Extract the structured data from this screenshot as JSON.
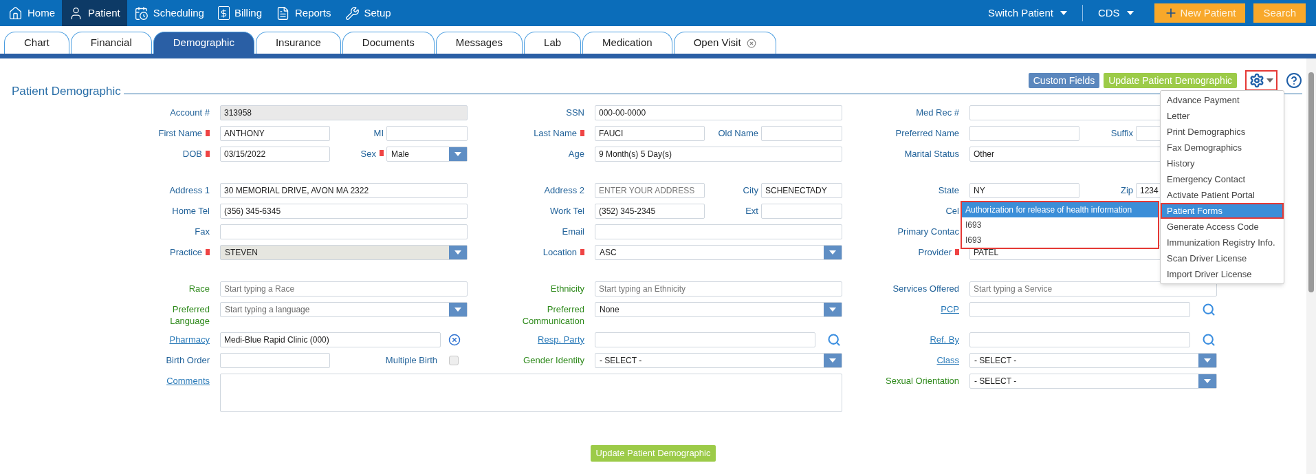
{
  "nav": {
    "items": [
      {
        "label": "Home",
        "selected": false
      },
      {
        "label": "Patient",
        "selected": true
      },
      {
        "label": "Scheduling",
        "selected": false
      },
      {
        "label": "Billing",
        "selected": false
      },
      {
        "label": "Reports",
        "selected": false
      },
      {
        "label": "Setup",
        "selected": false
      }
    ],
    "menus": [
      {
        "label": "Switch Patient"
      },
      {
        "label": "CDS"
      }
    ],
    "actions": [
      {
        "label": "New Patient",
        "kind": "add"
      },
      {
        "label": "Search",
        "kind": "plain"
      }
    ]
  },
  "tabs": [
    {
      "label": "Chart",
      "selected": false,
      "closable": false
    },
    {
      "label": "Financial",
      "selected": false,
      "closable": false
    },
    {
      "label": "Demographic",
      "selected": true,
      "closable": false
    },
    {
      "label": "Insurance",
      "selected": false,
      "closable": false
    },
    {
      "label": "Documents",
      "selected": false,
      "closable": false
    },
    {
      "label": "Messages",
      "selected": false,
      "closable": false
    },
    {
      "label": "Lab",
      "selected": false,
      "closable": false
    },
    {
      "label": "Medication",
      "selected": false,
      "closable": false
    },
    {
      "label": "Open Visit",
      "selected": false,
      "closable": true
    }
  ],
  "header": {
    "title": "Patient Demographic",
    "buttons": [
      {
        "label": "Custom Fields",
        "kind": "secondary"
      },
      {
        "label": "Update Patient Demographic",
        "kind": "primary"
      }
    ],
    "settings_highlighted": true
  },
  "form": {
    "sections": [
      {
        "rows": [
          [
            {
              "kind": "input",
              "label": {
                "text": "Account #",
                "kind": "plain",
                "required": false
              },
              "value": "313958",
              "disabled": true
            },
            {
              "kind": "input",
              "label": {
                "text": "SSN",
                "kind": "plain",
                "required": false
              },
              "value": "000-00-0000",
              "disabled": false
            },
            {
              "kind": "input",
              "label": {
                "text": "Med Rec #",
                "kind": "plain",
                "required": false
              },
              "disabled": false
            }
          ],
          [
            {
              "kind": "split",
              "label": {
                "text": "First Name",
                "kind": "plain",
                "required": true
              },
              "value": "ANTHONY",
              "second": {
                "kind": "input",
                "label": "MI",
                "required": false
              }
            },
            {
              "kind": "split",
              "label": {
                "text": "Last Name",
                "kind": "plain",
                "required": true
              },
              "value": "FAUCI",
              "second": {
                "kind": "input",
                "label": "Old Name",
                "required": false
              }
            },
            {
              "kind": "split",
              "label": {
                "text": "Preferred Name",
                "kind": "plain",
                "required": false
              },
              "second": {
                "kind": "input",
                "label": "Suffix",
                "required": false
              }
            }
          ],
          [
            {
              "kind": "split",
              "label": {
                "text": "DOB",
                "kind": "plain",
                "required": true
              },
              "value": "03/15/2022",
              "second": {
                "kind": "select",
                "label": "Sex",
                "required": true,
                "value": "Male"
              }
            },
            {
              "kind": "input",
              "label": {
                "text": "Age",
                "kind": "plain",
                "required": false
              },
              "value": "9 Month(s) 5 Day(s)",
              "disabled": false
            },
            {
              "kind": "input",
              "label": {
                "text": "Marital Status",
                "kind": "plain",
                "required": false
              },
              "value": "Other",
              "disabled": false
            }
          ]
        ]
      },
      {
        "rows": [
          [
            {
              "kind": "input",
              "label": {
                "text": "Address 1",
                "kind": "plain",
                "required": false
              },
              "value": "30 MEMORIAL DRIVE, AVON MA 2322",
              "disabled": false
            },
            {
              "kind": "split",
              "label": {
                "text": "Address 2",
                "kind": "plain",
                "required": false
              },
              "placeholder": "ENTER YOUR ADDRESS",
              "second": {
                "kind": "input",
                "label": "City",
                "required": false,
                "value": "SCHENECTADY"
              }
            },
            {
              "kind": "split",
              "label": {
                "text": "State",
                "kind": "plain",
                "required": false
              },
              "value": "NY",
              "second": {
                "kind": "input",
                "label": "Zip",
                "required": false,
                "value": "1234"
              }
            }
          ],
          [
            {
              "kind": "input",
              "label": {
                "text": "Home Tel",
                "kind": "plain",
                "required": false
              },
              "value": "(356) 345-6345",
              "disabled": false
            },
            {
              "kind": "split",
              "label": {
                "text": "Work Tel",
                "kind": "plain",
                "required": false
              },
              "value": "(352) 345-2345",
              "second": {
                "kind": "input",
                "label": "Ext",
                "required": false
              }
            },
            {
              "kind": "hidden",
              "label": {
                "text": "Cel",
                "kind": "plain",
                "required": false
              }
            }
          ],
          [
            {
              "kind": "input",
              "label": {
                "text": "Fax",
                "kind": "plain",
                "required": false
              },
              "disabled": false
            },
            {
              "kind": "input",
              "label": {
                "text": "Email",
                "kind": "plain",
                "required": false
              },
              "disabled": false
            },
            {
              "kind": "hidden",
              "label": {
                "text": "Primary Contac",
                "kind": "plain",
                "required": false
              }
            }
          ],
          [
            {
              "kind": "select",
              "label": {
                "text": "Practice",
                "kind": "plain",
                "required": true
              },
              "value": "STEVEN",
              "disabled": true
            },
            {
              "kind": "select",
              "label": {
                "text": "Location",
                "kind": "plain",
                "required": true
              },
              "value": "ASC",
              "disabled": false
            },
            {
              "kind": "input",
              "label": {
                "text": "Provider",
                "kind": "plain",
                "required": true
              },
              "value": "PATEL",
              "disabled": false
            }
          ]
        ]
      },
      {
        "rows": [
          [
            {
              "kind": "input",
              "label": {
                "text": "Race",
                "kind": "green",
                "required": false
              },
              "placeholder": "Start typing a Race",
              "disabled": false
            },
            {
              "kind": "input",
              "label": {
                "text": "Ethnicity",
                "kind": "green",
                "required": false
              },
              "placeholder": "Start typing an Ethnicity",
              "disabled": false
            },
            {
              "kind": "input",
              "label": {
                "text": "Services Offered",
                "kind": "plain",
                "required": false
              },
              "placeholder": "Start typing a Service",
              "disabled": false
            }
          ],
          [
            {
              "kind": "select",
              "label": {
                "text": "Preferred Language",
                "kind": "green",
                "required": false
              },
              "placeholder": "Start typing a language",
              "disabled": false
            },
            {
              "kind": "select",
              "label": {
                "text": "Preferred Communication",
                "kind": "green",
                "required": false
              },
              "value": "None",
              "disabled": false
            },
            {
              "kind": "search",
              "label": {
                "text": "PCP",
                "kind": "link",
                "required": false
              }
            }
          ],
          [
            {
              "kind": "clearable",
              "label": {
                "text": "Pharmacy",
                "kind": "link",
                "required": false
              },
              "value": "Medi-Blue Rapid Clinic (000)"
            },
            {
              "kind": "search",
              "label": {
                "text": "Resp. Party",
                "kind": "link",
                "required": false
              }
            },
            {
              "kind": "search",
              "label": {
                "text": "Ref. By",
                "kind": "link",
                "required": false
              }
            }
          ],
          [
            {
              "kind": "split",
              "label": {
                "text": "Birth Order",
                "kind": "plain",
                "required": false
              },
              "second": {
                "kind": "checkbox",
                "label": "Multiple Birth",
                "required": false,
                "checked": false
              }
            },
            {
              "kind": "select",
              "label": {
                "text": "Gender Identity",
                "kind": "green",
                "required": false
              },
              "value": "- SELECT -",
              "disabled": false
            },
            {
              "kind": "select",
              "label": {
                "text": "Class",
                "kind": "link",
                "required": false
              },
              "value": "- SELECT -",
              "disabled": false
            }
          ],
          [
            {
              "kind": "textarea",
              "label": {
                "text": "Comments",
                "kind": "link",
                "required": false
              }
            },
            "",
            {
              "kind": "select",
              "label": {
                "text": "Sexual Orientation",
                "kind": "green",
                "required": false
              },
              "value": "- SELECT -",
              "disabled": false
            }
          ]
        ]
      }
    ]
  },
  "footer_button": "Update Patient Demographic",
  "settings_menu": {
    "items": [
      {
        "label": "Advance Payment",
        "selected": false,
        "highlighted": false
      },
      {
        "label": "Letter",
        "selected": false,
        "highlighted": false
      },
      {
        "label": "Print Demographics",
        "selected": false,
        "highlighted": false
      },
      {
        "label": "Fax Demographics",
        "selected": false,
        "highlighted": false
      },
      {
        "label": "History",
        "selected": false,
        "highlighted": false
      },
      {
        "label": "Emergency Contact",
        "selected": false,
        "highlighted": false
      },
      {
        "label": "Activate Patient Portal",
        "selected": false,
        "highlighted": false
      },
      {
        "label": "Patient Forms",
        "selected": true,
        "highlighted": true
      },
      {
        "label": "Generate Access Code",
        "selected": false,
        "highlighted": false
      },
      {
        "label": "Immunization Registry Info.",
        "selected": false,
        "highlighted": false
      },
      {
        "label": "Scan Driver License",
        "selected": false,
        "highlighted": false
      },
      {
        "label": "Import Driver License",
        "selected": false,
        "highlighted": false
      }
    ]
  },
  "forms_submenu": {
    "highlighted": true,
    "items": [
      {
        "label": "Authorization for release of health information",
        "selected": true
      },
      {
        "label": "I693",
        "selected": false
      },
      {
        "label": "I693",
        "selected": false
      }
    ]
  }
}
